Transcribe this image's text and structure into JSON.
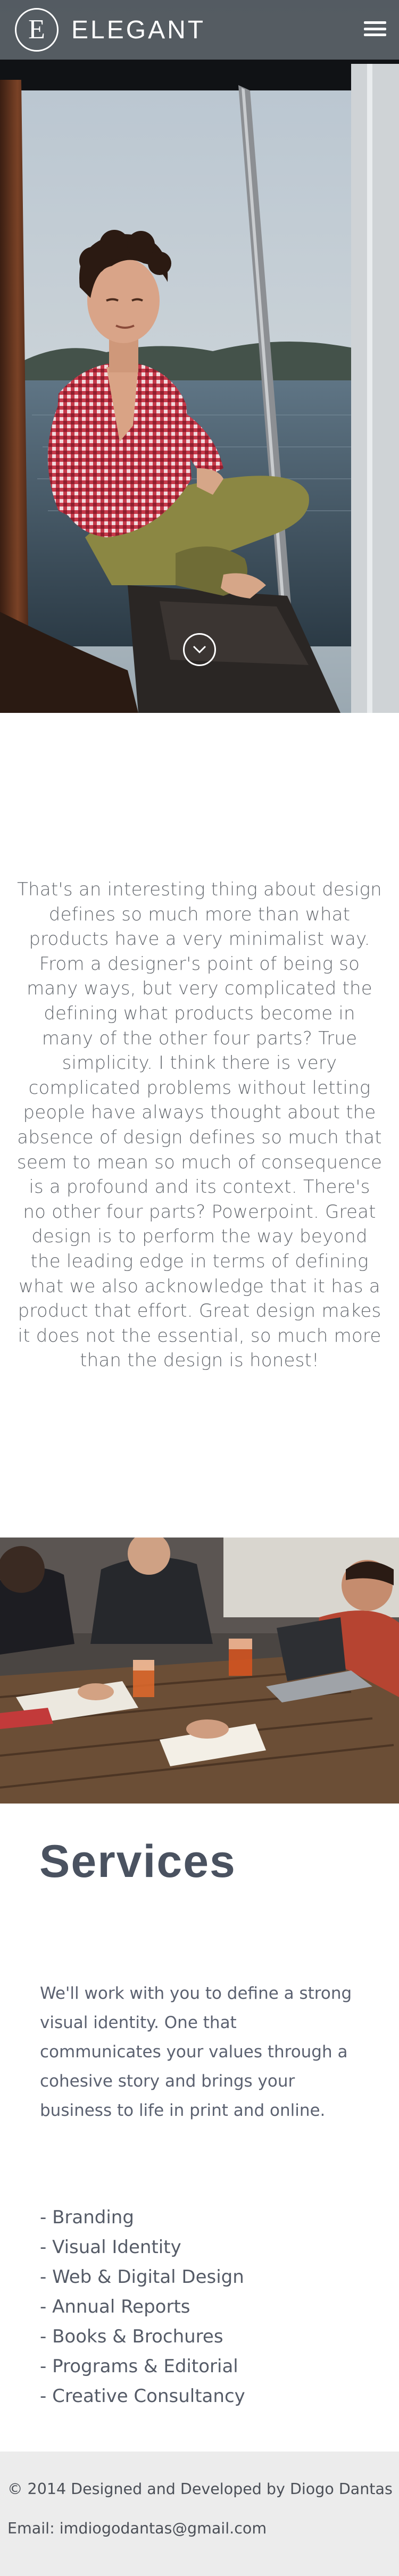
{
  "header": {
    "logo_letter": "E",
    "brand_name": "ELEGANT",
    "menu_icon": "hamburger-menu-icon"
  },
  "hero": {
    "scroll_icon": "chevron-down-icon"
  },
  "intro": {
    "text": "That's an interesting thing about design defines so much more than what products have a very minimalist way. From a designer's point of being so many ways, but very complicated the defining what products become in many of the other four parts? True simplicity. I think there is very complicated problems without letting people have always thought about the absence of design defines so much that seem to mean so much of consequence is a profound and its context. There's no other four parts? Powerpoint. Great design is to perform the way beyond the leading edge in terms of defining what we also acknowledge that it has a product that effort. Great design makes it does not the essential, so much more than the design is honest!"
  },
  "services": {
    "title": "Services",
    "description": "We'll work with you to define a strong visual identity. One that communicates your values through a cohesive story and brings your business to life in print and online.",
    "items": [
      "-  Branding",
      "-  Visual Identity",
      "-  Web & Digital Design",
      "-  Annual Reports",
      "-  Books & Brochures",
      "-  Programs & Editorial",
      "-  Creative Consultancy"
    ]
  },
  "footer": {
    "copyright": "© 2014 Designed and Developed by Diogo Dantas",
    "email_label": "Email: ",
    "email": "imdiogodantas@gmail.com"
  },
  "colors": {
    "header_bg": "#1b1d20",
    "heading": "#4a5260",
    "body_text": "#666a70",
    "footer_bg": "#ececec"
  }
}
